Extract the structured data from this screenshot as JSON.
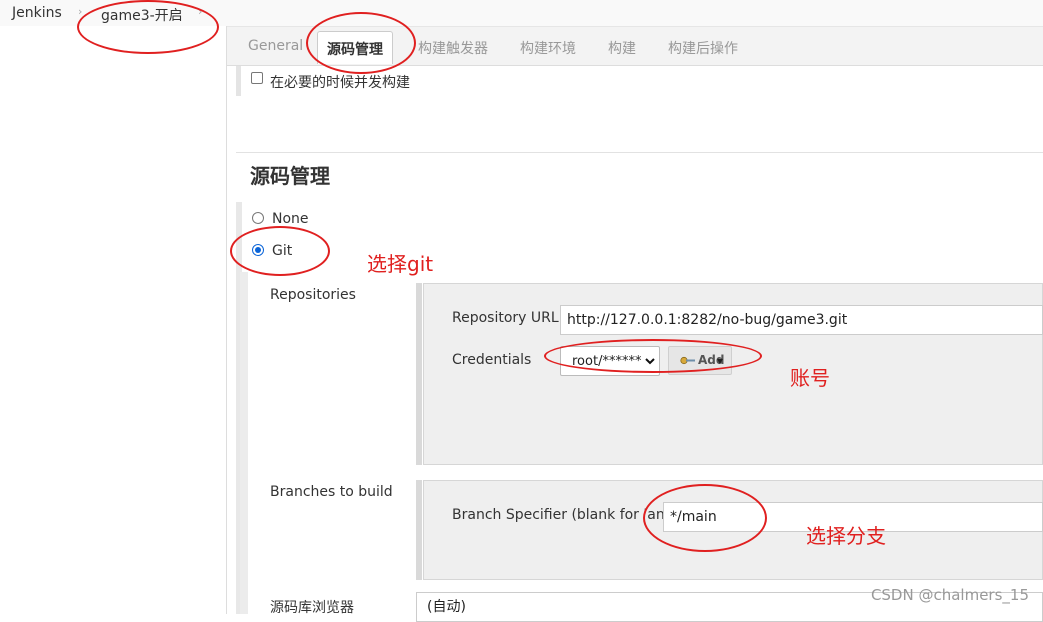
{
  "breadcrumb": {
    "items": [
      {
        "label": "Jenkins"
      },
      {
        "label": "game3-开启"
      }
    ],
    "separator": "›"
  },
  "tabs": [
    {
      "label": "General",
      "active": false
    },
    {
      "label": "源码管理",
      "active": true
    },
    {
      "label": "构建触发器",
      "active": false
    },
    {
      "label": "构建环境",
      "active": false
    },
    {
      "label": "构建",
      "active": false
    },
    {
      "label": "构建后操作",
      "active": false
    }
  ],
  "trigger": {
    "checkbox_label": "在必要的时候并发构建",
    "checked": false
  },
  "scm": {
    "section_title": "源码管理",
    "options": [
      {
        "label": "None",
        "selected": false
      },
      {
        "label": "Git",
        "selected": true
      }
    ],
    "repositories": {
      "label": "Repositories",
      "url_label": "Repository URL",
      "url_value": "http://127.0.0.1:8282/no-bug/game3.git",
      "credentials_label": "Credentials",
      "credentials_value": "root/******",
      "add_button": "Add"
    },
    "branches": {
      "label": "Branches to build",
      "specifier_label": "Branch Specifier (blank for 'any')",
      "specifier_value": "*/main"
    },
    "browser": {
      "label": "源码库浏览器",
      "value": "(自动)"
    }
  },
  "annotations": {
    "select_git": "选择git",
    "account": "账号",
    "select_branch": "选择分支",
    "color": "#e0201f"
  },
  "watermark": "CSDN @chalmers_15"
}
